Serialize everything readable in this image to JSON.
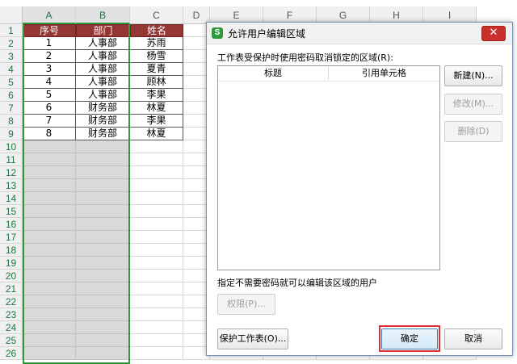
{
  "sheet": {
    "columns": [
      "A",
      "B",
      "C",
      "D",
      "E",
      "F",
      "G",
      "H",
      "I"
    ],
    "rows": [
      "1",
      "2",
      "3",
      "4",
      "5",
      "6",
      "7",
      "8",
      "9",
      "10",
      "11",
      "12",
      "13",
      "14",
      "15",
      "16",
      "17",
      "18",
      "19",
      "20",
      "21",
      "22",
      "23",
      "24",
      "25",
      "26"
    ],
    "headers": [
      "序号",
      "部门",
      "姓名"
    ],
    "data": [
      [
        "1",
        "人事部",
        "苏雨"
      ],
      [
        "2",
        "人事部",
        "杨雪"
      ],
      [
        "3",
        "人事部",
        "夏青"
      ],
      [
        "4",
        "人事部",
        "顾林"
      ],
      [
        "5",
        "人事部",
        "李果"
      ],
      [
        "6",
        "财务部",
        "林夏"
      ],
      [
        "7",
        "财务部",
        "李果"
      ],
      [
        "8",
        "财务部",
        "林夏"
      ]
    ],
    "colors": {
      "header_fill": "#943634",
      "selection_border": "#2e9a3c",
      "selected_fill": "#d9d9d9"
    }
  },
  "dialog": {
    "app_icon": "S",
    "title": "允许用户编辑区域",
    "close_glyph": "✕",
    "ranges_label": "工作表受保护时使用密码取消锁定的区域(R):",
    "list_columns": [
      "标题",
      "引用单元格"
    ],
    "new_button": "新建(N)...",
    "modify_button": "修改(M)...",
    "delete_button": "删除(D)",
    "users_label": "指定不需要密码就可以编辑该区域的用户",
    "permissions_button": "权限(P)...",
    "protect_button": "保护工作表(O)...",
    "ok_button": "确定",
    "cancel_button": "取消",
    "colors": {
      "highlight": "#e0303a",
      "close_bg": "#c9302c"
    }
  }
}
